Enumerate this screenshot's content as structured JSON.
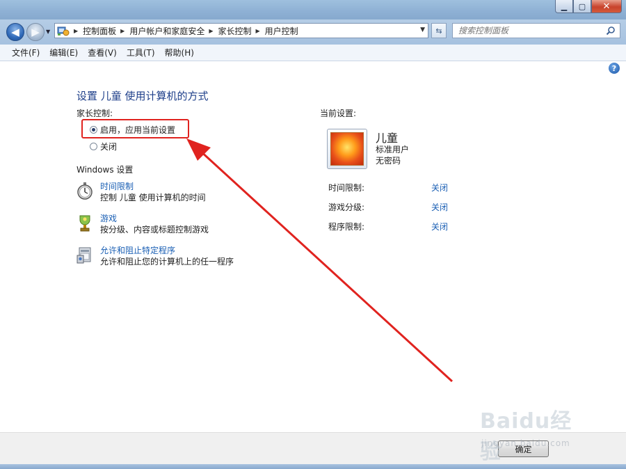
{
  "window": {
    "caption_buttons": [
      "minimize-icon",
      "maximize-icon",
      "close-icon"
    ]
  },
  "address": {
    "crumbs": [
      "控制面板",
      "用户帐户和家庭安全",
      "家长控制",
      "用户控制"
    ]
  },
  "search": {
    "placeholder": "搜索控制面板"
  },
  "menu": {
    "items": [
      "文件(F)",
      "编辑(E)",
      "查看(V)",
      "工具(T)",
      "帮助(H)"
    ]
  },
  "main": {
    "heading": "设置 儿童 使用计算机的方式",
    "parental_label": "家长控制:",
    "options": [
      {
        "label": "启用，应用当前设置",
        "selected": true
      },
      {
        "label": "关闭",
        "selected": false
      }
    ],
    "windows_settings_label": "Windows 设置",
    "items": [
      {
        "title": "时间限制",
        "desc": "控制 儿童 使用计算机的时间",
        "icon": "stopwatch-icon"
      },
      {
        "title": "游戏",
        "desc": "按分级、内容或标题控制游戏",
        "icon": "game-trophy-icon"
      },
      {
        "title": "允许和阻止特定程序",
        "desc": "允许和阻止您的计算机上的任一程序",
        "icon": "program-icon"
      }
    ]
  },
  "current": {
    "label": "当前设置:",
    "user_name": "儿童",
    "user_type": "标准用户",
    "password": "无密码",
    "rows": [
      {
        "key": "时间限制:",
        "value": "关闭"
      },
      {
        "key": "游戏分级:",
        "value": "关闭"
      },
      {
        "key": "程序限制:",
        "value": "关闭"
      }
    ]
  },
  "footer": {
    "ok_label": "确定"
  },
  "annotation": {
    "color": "#e0231f"
  },
  "watermark": {
    "logo": "Baidu经验",
    "url": "jingyan.baidu.com"
  }
}
